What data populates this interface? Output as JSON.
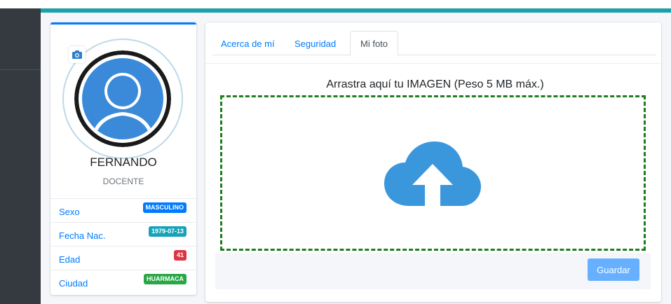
{
  "profile": {
    "name": "FERNANDO",
    "role": "DOCENTE",
    "info": [
      {
        "label": "Sexo",
        "value": "MASCULINO",
        "color": "#007bff"
      },
      {
        "label": "Fecha Nac.",
        "value": "1979-07-13",
        "color": "#17a2b8"
      },
      {
        "label": "Edad",
        "value": "41",
        "color": "#dc3545"
      },
      {
        "label": "Ciudad",
        "value": "HUARMACA",
        "color": "#28a745"
      }
    ]
  },
  "tabs": [
    {
      "label": "Acerca de mí",
      "active": false
    },
    {
      "label": "Seguridad",
      "active": false
    },
    {
      "label": "Mi foto",
      "active": true
    }
  ],
  "upload": {
    "title": "Arrastra aquí tu IMAGEN (Peso 5 MB máx.)",
    "icon": "cloud-upload-icon",
    "save_label": "Guardar"
  },
  "colors": {
    "accent": "#1ba0a8",
    "primary": "#007bff",
    "dropzone_border": "#1e7e1e",
    "cloud": "#3b97dc"
  }
}
